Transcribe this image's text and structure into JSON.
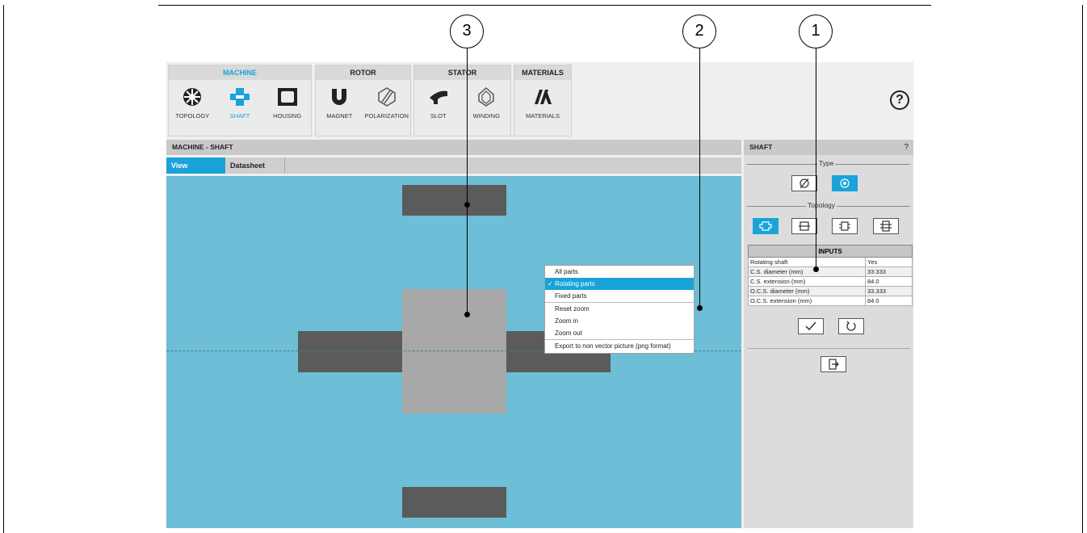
{
  "ribbon": {
    "machine": {
      "title": "MACHINE",
      "items": [
        "TOPOLOGY",
        "SHAFT",
        "HOUSING"
      ]
    },
    "rotor": {
      "title": "ROTOR",
      "items": [
        "MAGNET",
        "POLARIZATION"
      ]
    },
    "stator": {
      "title": "STATOR",
      "items": [
        "SLOT",
        "WINDING"
      ]
    },
    "materials": {
      "title": "MATERIALS",
      "items": [
        "MATERIALS"
      ]
    },
    "help": "?"
  },
  "main": {
    "header": "MACHINE - SHAFT",
    "tabs": [
      "View",
      "Datasheet"
    ]
  },
  "context_menu": {
    "items": [
      "All parts",
      "Rotating parts",
      "Fixed parts",
      "Reset zoom",
      "Zoom in",
      "Zoom out",
      "Export to non vector picture (png format)"
    ],
    "checkmark": "✓"
  },
  "side_panel": {
    "header": "SHAFT",
    "help": "?",
    "type_legend": "Type",
    "topology_legend": "Topology",
    "inputs_title": "INPUTS",
    "inputs": [
      {
        "label": "Rotating shaft",
        "value": "Yes"
      },
      {
        "label": "C.S. diameter (mm)",
        "value": "33.333"
      },
      {
        "label": "C.S. extension (mm)",
        "value": "84.0"
      },
      {
        "label": "O.C.S. diameter (mm)",
        "value": "33.333"
      },
      {
        "label": "O.C.S. extension (mm)",
        "value": "84.0"
      }
    ]
  },
  "callouts": [
    "1",
    "2",
    "3"
  ],
  "colors": {
    "accent": "#1aa3d9",
    "viewer_bg": "#6dbed6"
  }
}
